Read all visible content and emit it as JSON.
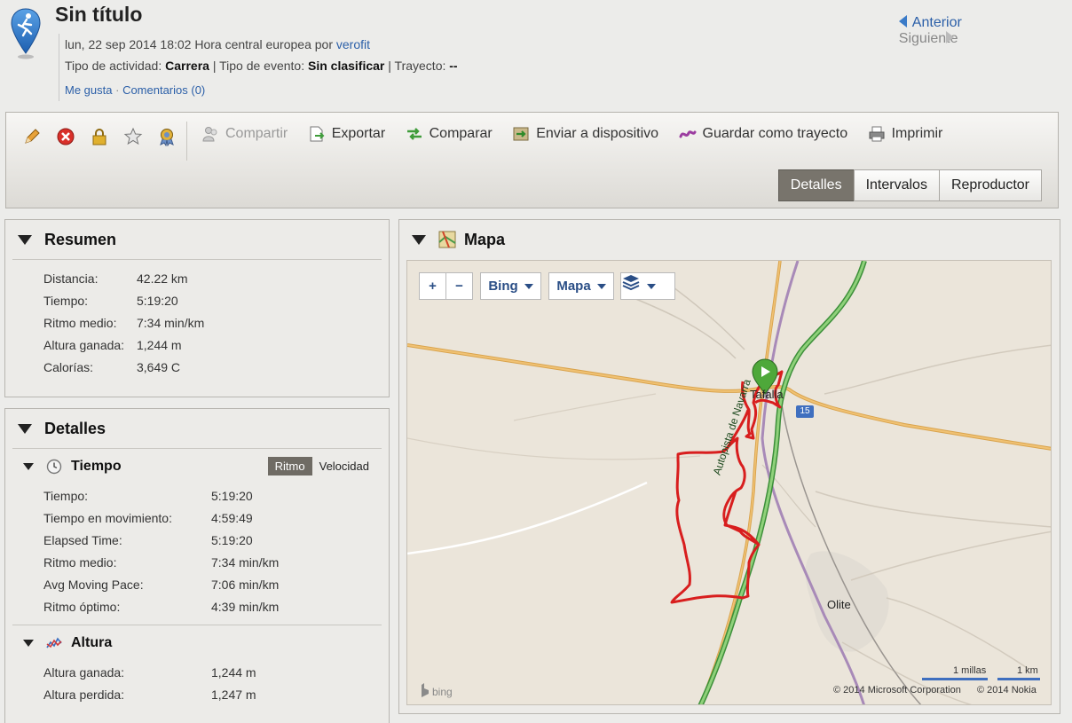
{
  "header": {
    "title": "Sin título",
    "date_line": "lun, 22 sep 2014 18:02 Hora central europea por",
    "user": "verofit",
    "activity_label": "Tipo de actividad:",
    "activity_value": "Carrera",
    "event_label": "| Tipo de evento:",
    "event_value": "Sin clasificar",
    "route_label": "| Trayecto:",
    "route_value": "--",
    "like": "Me gusta",
    "comments": "Comentarios (0)",
    "prev": "Anterior",
    "next": "Siguiente"
  },
  "toolbar": {
    "share": "Compartir",
    "export": "Exportar",
    "compare": "Comparar",
    "send": "Enviar a dispositivo",
    "save_route": "Guardar como trayecto",
    "print": "Imprimir",
    "tabs": [
      "Detalles",
      "Intervalos",
      "Reproductor"
    ]
  },
  "resumen": {
    "title": "Resumen",
    "rows": [
      {
        "k": "Distancia:",
        "v": "42.22 km"
      },
      {
        "k": "Tiempo:",
        "v": "5:19:20"
      },
      {
        "k": "Ritmo medio:",
        "v": "7:34 min/km"
      },
      {
        "k": "Altura ganada:",
        "v": "1,244 m"
      },
      {
        "k": "Calorías:",
        "v": "3,649 C"
      }
    ]
  },
  "detalles": {
    "title": "Detalles",
    "tiempo_title": "Tiempo",
    "toggle_on": "Ritmo",
    "toggle_off": "Velocidad",
    "tiempo_rows": [
      {
        "k": "Tiempo:",
        "v": "5:19:20"
      },
      {
        "k": "Tiempo en movimiento:",
        "v": "4:59:49"
      },
      {
        "k": "Elapsed Time:",
        "v": "5:19:20"
      },
      {
        "k": "Ritmo medio:",
        "v": "7:34 min/km"
      },
      {
        "k": "Avg Moving Pace:",
        "v": "7:06 min/km"
      },
      {
        "k": "Ritmo óptimo:",
        "v": "4:39 min/km"
      }
    ],
    "altura_title": "Altura",
    "altura_rows": [
      {
        "k": "Altura ganada:",
        "v": "1,244 m"
      },
      {
        "k": "Altura perdida:",
        "v": "1,247 m"
      }
    ]
  },
  "mapa": {
    "title": "Mapa",
    "zoom_in": "+",
    "zoom_out": "−",
    "provider": "Bing",
    "map_type": "Mapa",
    "town1": "Tafalla",
    "town2": "Olite",
    "road_label": "Autopista de Navarra",
    "road_badge": "15",
    "scale_miles": "1 millas",
    "scale_km": "1 km",
    "copyright_ms": "© 2014 Microsoft Corporation",
    "copyright_nokia": "© 2014 Nokia",
    "bing_logo": "bing"
  },
  "colors": {
    "route": "#dc1e1e",
    "motorway": "#5fb55a",
    "road_orange": "#e3a94a",
    "rail": "#b79bc4",
    "link": "#2b5fa8"
  }
}
